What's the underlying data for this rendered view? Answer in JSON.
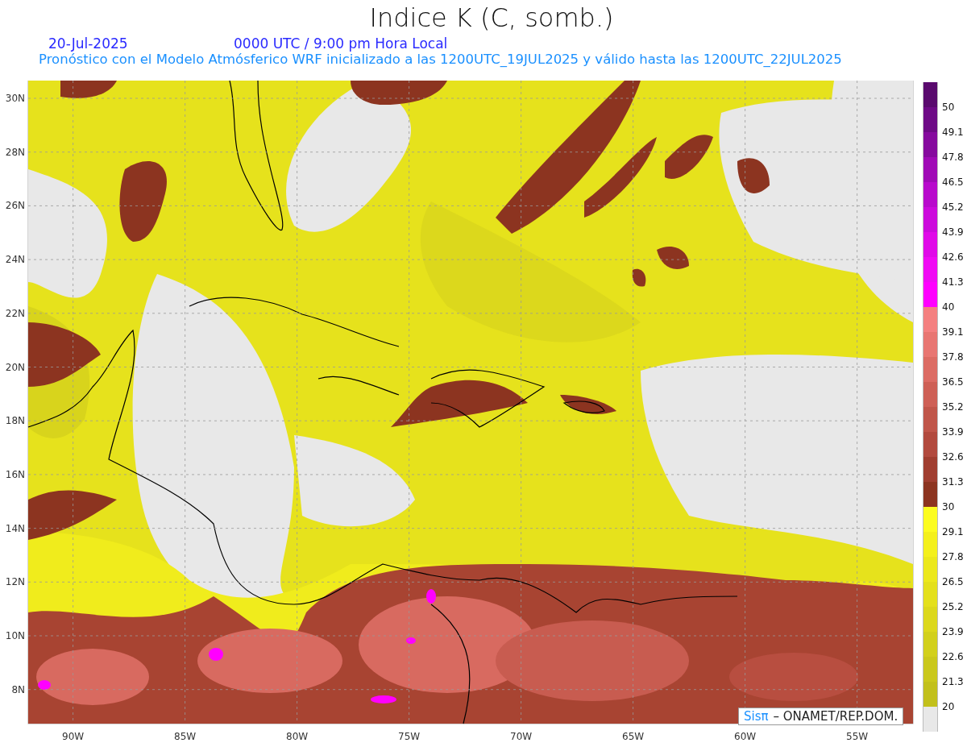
{
  "title": "Indice K (C, somb.)",
  "date": "20-Jul-2025",
  "time": "0000 UTC / 9:00 pm Hora Local",
  "subtitle": "Pronóstico con el Modelo Atmósferico WRF inicializado a las 1200UTC_19JUL2025 y válido hasta las  1200UTC_22JUL2025",
  "map": {
    "lat_labels": [
      "30N",
      "28N",
      "26N",
      "24N",
      "22N",
      "20N",
      "18N",
      "16N",
      "14N",
      "12N",
      "10N",
      "8N"
    ],
    "lon_labels": [
      "90W",
      "85W",
      "80W",
      "75W",
      "70W",
      "65W",
      "60W",
      "55W"
    ],
    "credit": {
      "brand": "Sisπ",
      "text": "– ONAMET/REP.DOM."
    }
  },
  "colorbar": [
    {
      "color": "#5a0a6e",
      "label": "50"
    },
    {
      "color": "#6e0a86",
      "label": "49.1"
    },
    {
      "color": "#860a9e",
      "label": "47.8"
    },
    {
      "color": "#a00ab6",
      "label": "46.5"
    },
    {
      "color": "#b80acc",
      "label": "45.2"
    },
    {
      "color": "#cc0adc",
      "label": "43.9"
    },
    {
      "color": "#e00ae8",
      "label": "42.6"
    },
    {
      "color": "#f00af4",
      "label": "41.3"
    },
    {
      "color": "#ff00ff",
      "label": "40"
    },
    {
      "color": "#f48080",
      "label": "39.1"
    },
    {
      "color": "#e87672",
      "label": "37.8"
    },
    {
      "color": "#dc6c64",
      "label": "36.5"
    },
    {
      "color": "#ce6056",
      "label": "35.2"
    },
    {
      "color": "#c0564a",
      "label": "33.9"
    },
    {
      "color": "#b24a3e",
      "label": "32.6"
    },
    {
      "color": "#a03e30",
      "label": "31.3"
    },
    {
      "color": "#8c3420",
      "label": "30"
    },
    {
      "color": "#fcfc20",
      "label": "29.1"
    },
    {
      "color": "#f4f01c",
      "label": "27.8"
    },
    {
      "color": "#ece81c",
      "label": "26.5"
    },
    {
      "color": "#e4e01c",
      "label": "25.2"
    },
    {
      "color": "#dcd81c",
      "label": "23.9"
    },
    {
      "color": "#d2d01c",
      "label": "22.6"
    },
    {
      "color": "#cac81c",
      "label": "21.3"
    },
    {
      "color": "#c2c01c",
      "label": "20"
    },
    {
      "color": "#e8e8e8"
    }
  ]
}
